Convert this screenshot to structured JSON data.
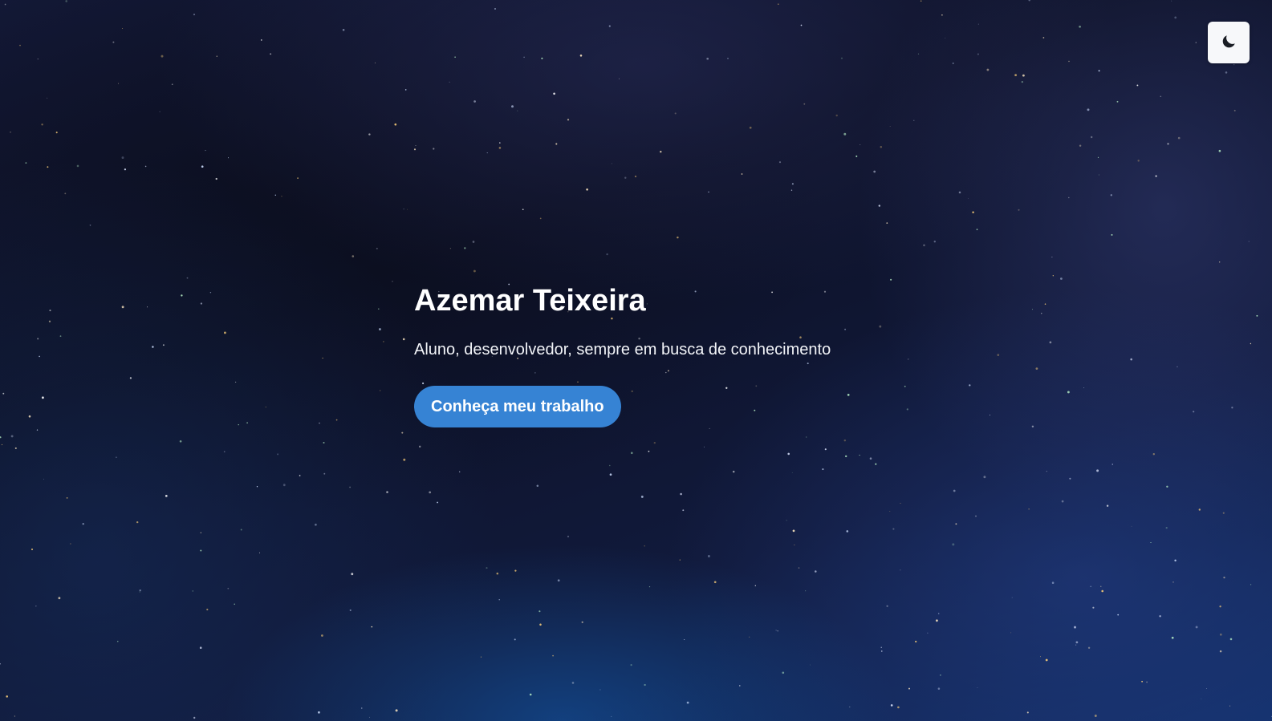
{
  "hero": {
    "name": "Azemar Teixeira",
    "tagline": "Aluno, desenvolvedor, sempre em busca de conhecimento",
    "cta_label": "Conheça meu trabalho"
  },
  "theme_toggle": {
    "icon": "moon-icon"
  },
  "colors": {
    "accent": "#3683d4",
    "background": "#0b1024",
    "toggle_bg": "#f7f8fa"
  }
}
